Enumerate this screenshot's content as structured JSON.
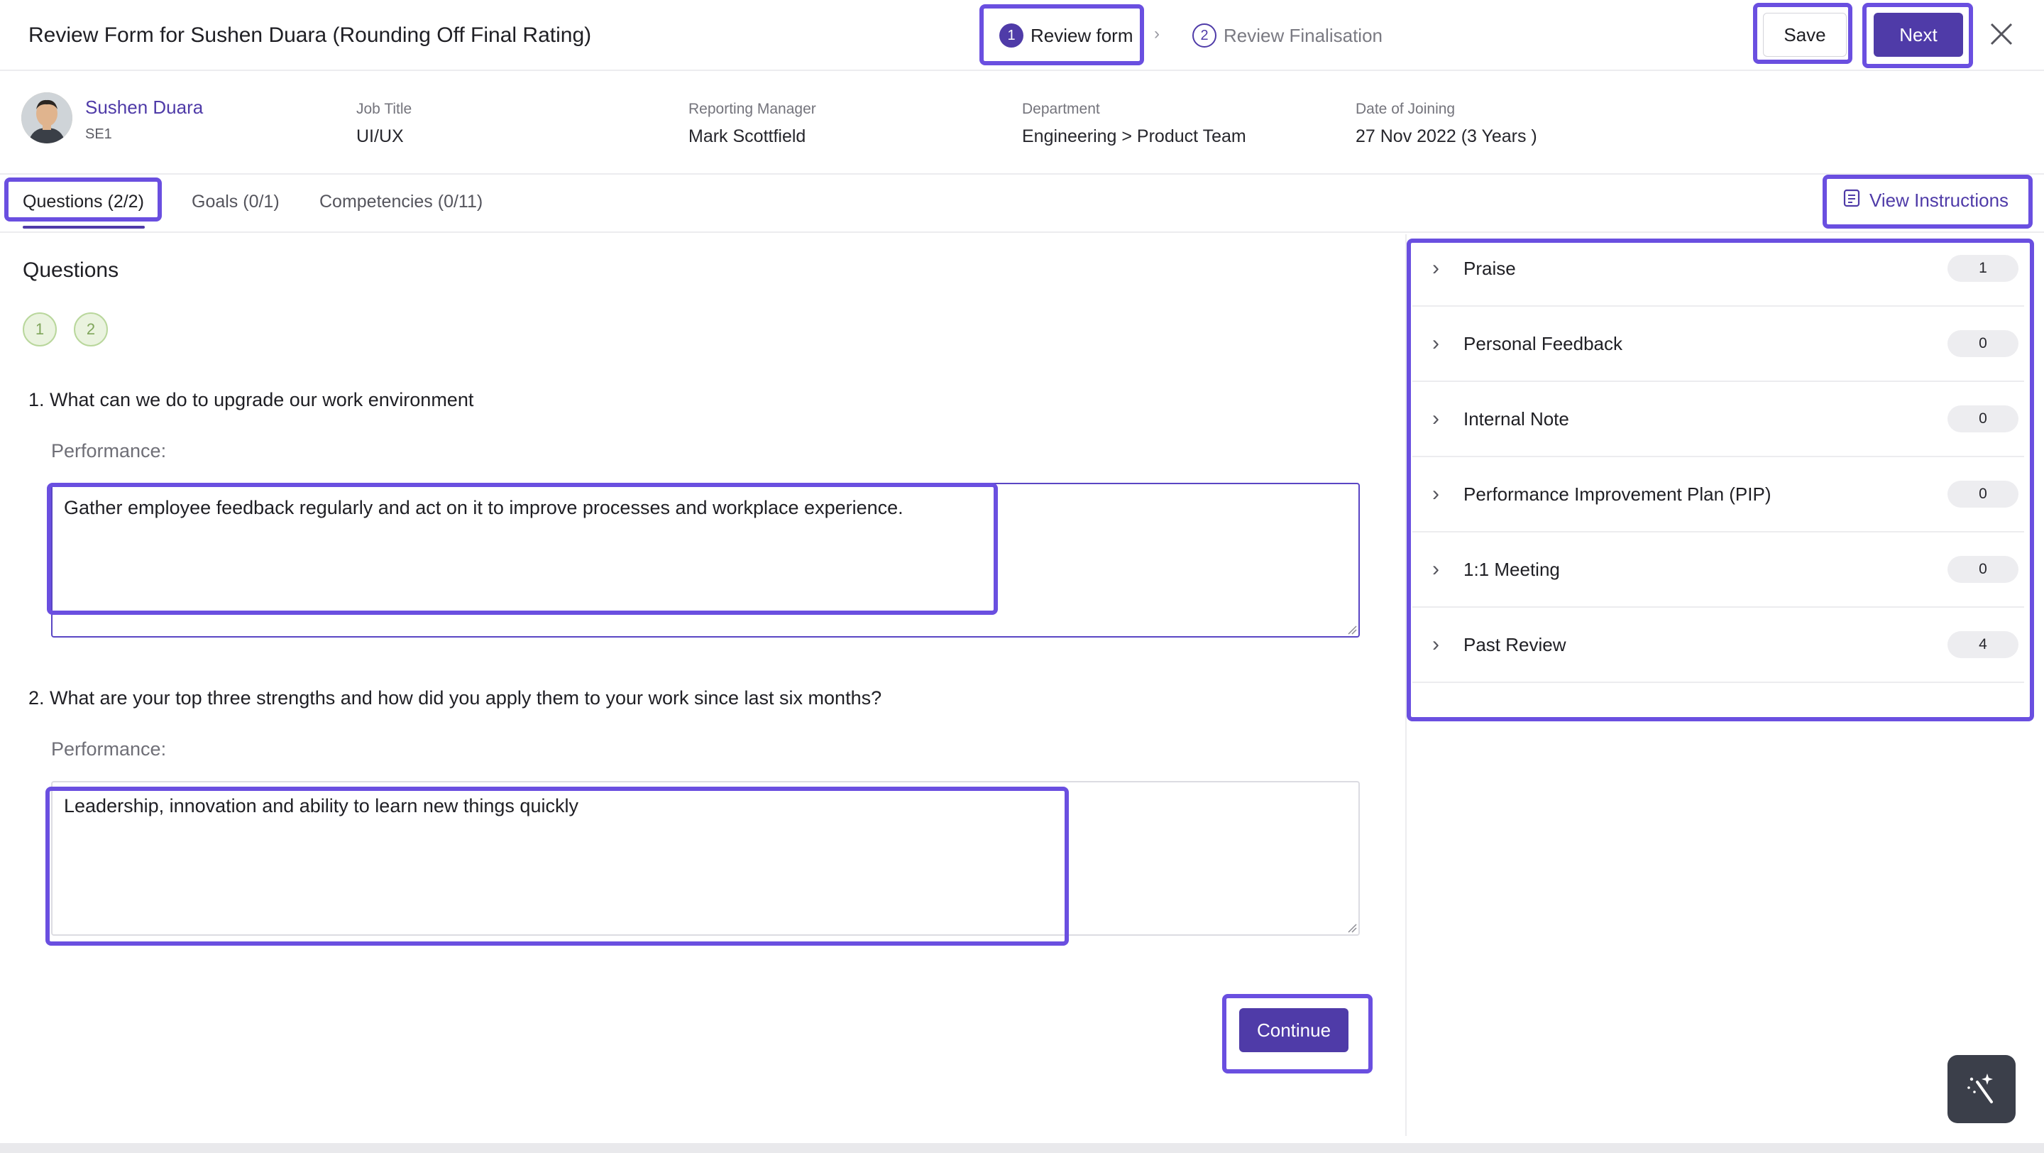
{
  "header": {
    "title": "Review Form for Sushen Duara (Rounding Off Final Rating)",
    "steps": [
      {
        "number": "1",
        "label": "Review form"
      },
      {
        "number": "2",
        "label": "Review Finalisation"
      }
    ],
    "save_label": "Save",
    "next_label": "Next"
  },
  "employee": {
    "name": "Sushen Duara",
    "code": "SE1",
    "fields": [
      {
        "label": "Job Title",
        "value": "UI/UX"
      },
      {
        "label": "Reporting Manager",
        "value": "Mark Scottfield"
      },
      {
        "label": "Department",
        "value": "Engineering > Product Team"
      },
      {
        "label": "Date of Joining",
        "value": "27 Nov 2022 (3 Years )"
      }
    ]
  },
  "tabs": [
    {
      "label": "Questions (2/2)"
    },
    {
      "label": "Goals (0/1)"
    },
    {
      "label": "Competencies (0/11)"
    }
  ],
  "view_instructions_label": "View Instructions",
  "questions_section": {
    "title": "Questions",
    "bubbles": [
      "1",
      "2"
    ],
    "items": [
      {
        "question": "1. What can we do to upgrade our work environment",
        "perf_label": "Performance:",
        "answer": "Gather employee feedback regularly and act on it to improve processes and workplace experience."
      },
      {
        "question": "2. What are your top three strengths and how did you apply them to your work since last six months?",
        "perf_label": "Performance:",
        "answer": "Leadership, innovation and ability to learn new things quickly"
      }
    ],
    "continue_label": "Continue"
  },
  "right_panel": {
    "items": [
      {
        "label": "Praise",
        "count": "1"
      },
      {
        "label": "Personal Feedback",
        "count": "0"
      },
      {
        "label": "Internal Note",
        "count": "0"
      },
      {
        "label": "Performance Improvement Plan (PIP)",
        "count": "0"
      },
      {
        "label": "1:1 Meeting",
        "count": "0"
      },
      {
        "label": "Past Review",
        "count": "4"
      }
    ]
  },
  "icons": {
    "close": "close-icon",
    "instructions": "document-icon",
    "expand": "chevron-right-icon",
    "assistant": "magic-wand-icon"
  },
  "colors": {
    "accent": "#4f3ba8",
    "highlight": "#6a4fe0",
    "bubble_bg": "#eaf3df",
    "bubble_text": "#7fa55b"
  }
}
